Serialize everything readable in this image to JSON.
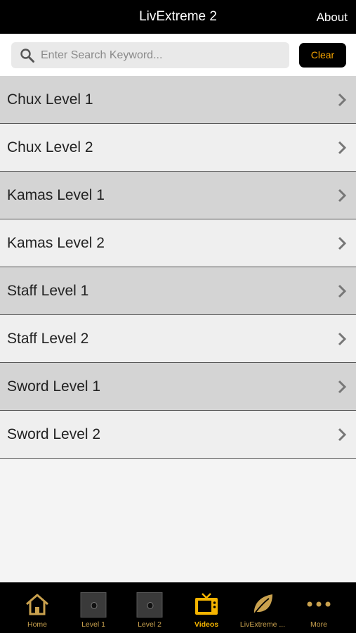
{
  "header": {
    "title": "LivExtreme 2",
    "about_label": "About"
  },
  "search": {
    "placeholder": "Enter Search Keyword...",
    "value": "",
    "clear_label": "Clear"
  },
  "list": {
    "items": [
      {
        "label": "Chux Level 1"
      },
      {
        "label": "Chux Level 2"
      },
      {
        "label": "Kamas Level 1"
      },
      {
        "label": "Kamas Level 2"
      },
      {
        "label": "Staff Level 1"
      },
      {
        "label": "Staff Level 2"
      },
      {
        "label": "Sword Level 1"
      },
      {
        "label": "Sword Level 2"
      }
    ]
  },
  "tabbar": {
    "tabs": [
      {
        "label": "Home",
        "icon": "home-icon"
      },
      {
        "label": "Level 1",
        "icon": "level-1-thumbnail"
      },
      {
        "label": "Level 2",
        "icon": "level-2-thumbnail"
      },
      {
        "label": "Videos",
        "icon": "tv-icon",
        "active": true
      },
      {
        "label": "LivExtreme ...",
        "icon": "leaf-icon"
      },
      {
        "label": "More",
        "icon": "more-dots-icon"
      }
    ]
  },
  "colors": {
    "accent": "#f5b400",
    "header_bg": "#000000",
    "row_dark": "#d4d4d4",
    "row_light": "#efefef"
  }
}
